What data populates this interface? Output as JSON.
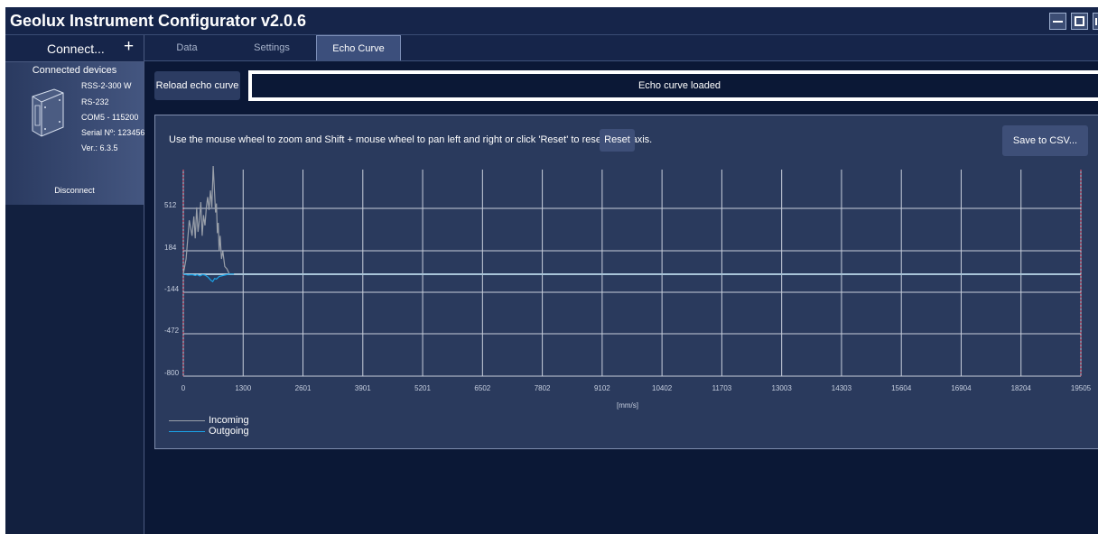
{
  "app": {
    "title": "Geolux Instrument Configurator v2.0.6"
  },
  "sidebar": {
    "connect_label": "Connect...",
    "plus_symbol": "+",
    "connected_title": "Connected devices",
    "device": {
      "model": "RSS-2-300 W",
      "interface": "RS-232",
      "port": "COM5 - 115200",
      "serial": "Serial Nº: 123456",
      "version": "Ver.: 6.3.5",
      "icon": "sensor-device-icon"
    },
    "disconnect_label": "Disconnect"
  },
  "tabs": [
    {
      "label": "Data",
      "active": false
    },
    {
      "label": "Settings",
      "active": false
    },
    {
      "label": "Echo Curve",
      "active": true
    }
  ],
  "echo": {
    "reload_label": "Reload echo curve",
    "status": "Echo curve loaded",
    "instructions": "Use the mouse wheel to zoom and Shift + mouse wheel to pan left and right or click 'Reset' to reset the x-axis.",
    "reset_label": "Reset",
    "save_label": "Save to CSV..."
  },
  "chart_data": {
    "type": "line",
    "xlabel": "[mm/s]",
    "ylabel": "",
    "x_ticks": [
      "0",
      "1300",
      "2601",
      "3901",
      "5201",
      "6502",
      "7802",
      "9102",
      "10402",
      "11703",
      "13003",
      "14303",
      "15604",
      "16904",
      "18204",
      "19505"
    ],
    "y_ticks": [
      "512",
      "184",
      "-144",
      "-472",
      "-800"
    ],
    "xlim": [
      0,
      19505
    ],
    "ylim": [
      -800,
      840
    ],
    "grid": true,
    "legend_position": "bottom-left",
    "series": [
      {
        "name": "Incoming",
        "color": "#9aa0aa",
        "x": [
          0,
          60,
          130,
          190,
          230,
          260,
          290,
          320,
          350,
          380,
          410,
          440,
          470,
          500,
          530,
          560,
          590,
          620,
          650,
          680,
          700,
          720,
          740,
          760,
          780,
          800,
          830,
          860,
          900,
          950,
          1000,
          1100
        ],
        "y": [
          0,
          120,
          420,
          300,
          450,
          280,
          520,
          330,
          420,
          560,
          300,
          460,
          380,
          520,
          600,
          500,
          650,
          520,
          840,
          620,
          480,
          550,
          320,
          400,
          180,
          300,
          120,
          180,
          60,
          40,
          0,
          0
        ]
      },
      {
        "name": "Outgoing",
        "color": "#1aa3e8",
        "x": [
          0,
          100,
          200,
          260,
          300,
          360,
          420,
          480,
          540,
          600,
          640,
          680,
          720,
          780,
          860,
          940,
          1000,
          1100
        ],
        "y": [
          0,
          -8,
          -5,
          -12,
          -5,
          -15,
          -4,
          -10,
          -25,
          -50,
          -60,
          -35,
          -40,
          -20,
          -12,
          -5,
          0,
          0
        ]
      }
    ]
  }
}
